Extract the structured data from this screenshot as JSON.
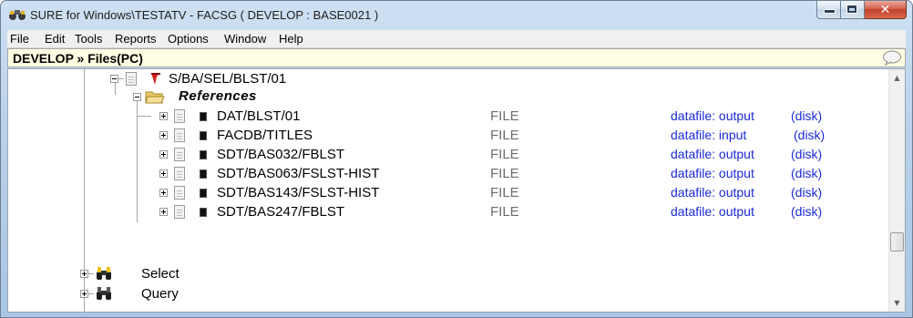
{
  "window": {
    "title": "SURE for Windows\\TESTATV - FACSG ( DEVELOP : BASE0021 )",
    "minimize": "–",
    "maximize": "□",
    "close": "✕"
  },
  "menu": [
    "File",
    "Edit",
    "Tools",
    "Reports",
    "Options",
    "Window",
    "Help"
  ],
  "breadcrumb": {
    "text": "DEVELOP » Files(PC)"
  },
  "tree": {
    "parent": {
      "label": "S/BA/SEL/BLST/01",
      "icon": "red-flag-icon"
    },
    "references_label": "References",
    "items": [
      {
        "name": "DAT/BLST/01",
        "type": "FILE",
        "role": "datafile: output",
        "media": "(disk)"
      },
      {
        "name": "FACDB/TITLES",
        "type": "FILE",
        "role": "datafile: input",
        "media": "(disk)"
      },
      {
        "name": "SDT/BAS032/FBLST",
        "type": "FILE",
        "role": "datafile: output",
        "media": "(disk)"
      },
      {
        "name": "SDT/BAS063/FSLST-HIST",
        "type": "FILE",
        "role": "datafile: output",
        "media": "(disk)"
      },
      {
        "name": "SDT/BAS143/FSLST-HIST",
        "type": "FILE",
        "role": "datafile: output",
        "media": "(disk)"
      },
      {
        "name": "SDT/BAS247/FBLST",
        "type": "FILE",
        "role": "datafile: output",
        "media": "(disk)"
      }
    ],
    "siblings": [
      {
        "label": "Select",
        "icon": "binoculars-yellow-icon"
      },
      {
        "label": "Query",
        "icon": "binoculars-icon"
      }
    ]
  },
  "scrollbar": {
    "up": "▲",
    "down": "▼"
  },
  "colors": {
    "link": "#1a2ad8",
    "breadcrumb_bg": "#fffde2",
    "type_text": "#6e6e6e"
  }
}
